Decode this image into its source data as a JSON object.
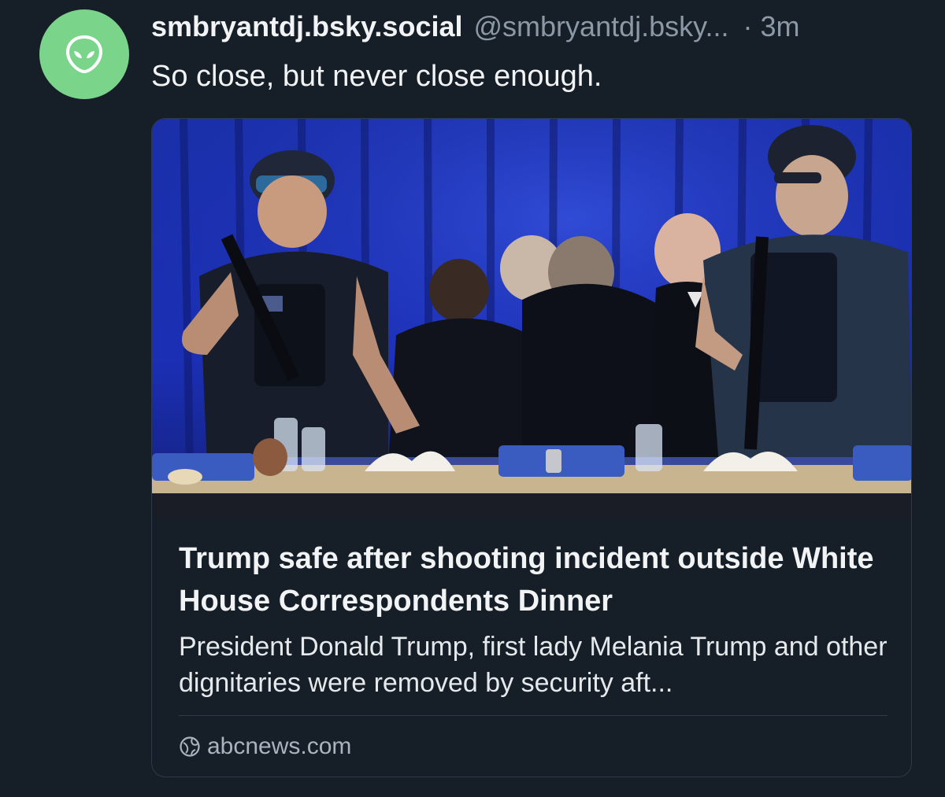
{
  "post": {
    "avatar_icon": "alien-icon",
    "avatar_color": "#7ad48a",
    "display_name": "smbryantdj.bsky.social",
    "handle": "@smbryantdj.bsky...",
    "separator": "·",
    "time": "3m",
    "text": "So close, but never close enough."
  },
  "link_card": {
    "image_description_icon": "news-photo",
    "title": "Trump safe after shooting incident outside White House Correspondents Dinner",
    "description": "President Donald Trump, first lady Melania Trump and other dignitaries were removed by security aft...",
    "source_icon": "globe-icon",
    "source": "abcnews.com"
  },
  "colors": {
    "background": "#161e27",
    "text_primary": "#f1f3f5",
    "text_secondary": "#8b98a5",
    "card_border": "#2e3a47"
  }
}
